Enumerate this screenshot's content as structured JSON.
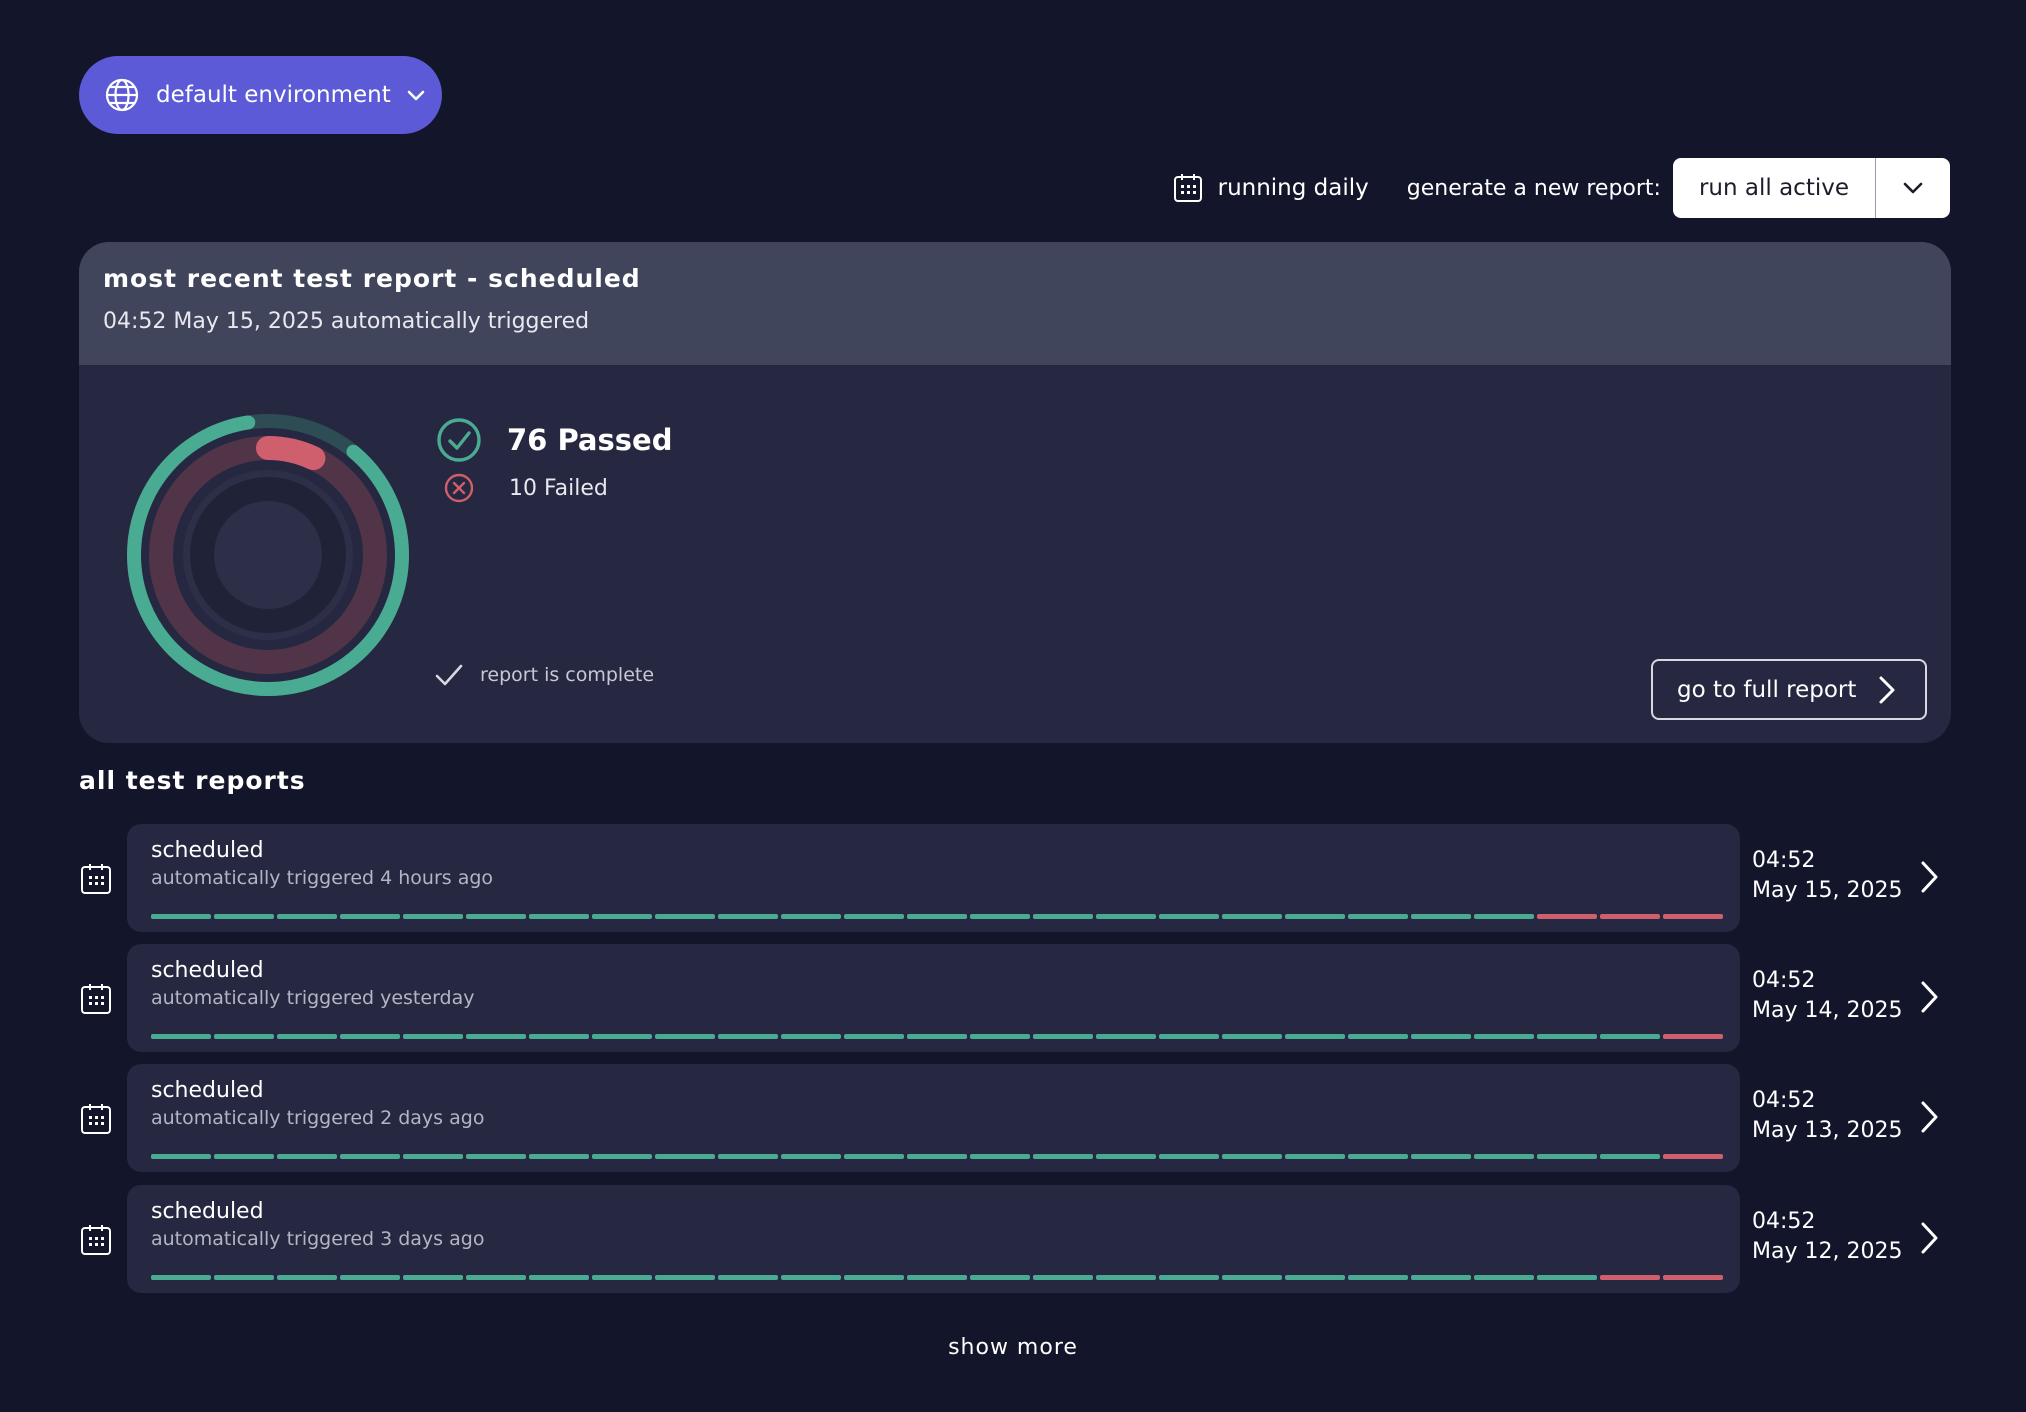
{
  "environment": {
    "label": "default environment",
    "icon": "globe-icon"
  },
  "toolbar": {
    "schedule_label": "running daily",
    "generate_label": "generate a new report:",
    "run_button_label": "run all active"
  },
  "latest_report": {
    "title": "most recent test report - scheduled",
    "subtitle": "04:52 May 15, 2025 automatically triggered",
    "passed_label": "76 Passed",
    "failed_label": "10 Failed",
    "passed": 76,
    "failed": 10,
    "status_label": "report is complete",
    "full_report_label": "go to full report"
  },
  "reports_section": {
    "title": "all test reports"
  },
  "reports": [
    {
      "title": "scheduled",
      "subtitle": "automatically triggered 4 hours ago",
      "time": "04:52",
      "date": "May 15, 2025",
      "passed_segments": 22,
      "failed_segments": 3
    },
    {
      "title": "scheduled",
      "subtitle": "automatically triggered yesterday",
      "time": "04:52",
      "date": "May 14, 2025",
      "passed_segments": 24,
      "failed_segments": 1
    },
    {
      "title": "scheduled",
      "subtitle": "automatically triggered 2 days ago",
      "time": "04:52",
      "date": "May 13, 2025",
      "passed_segments": 24,
      "failed_segments": 1
    },
    {
      "title": "scheduled",
      "subtitle": "automatically triggered 3 days ago",
      "time": "04:52",
      "date": "May 12, 2025",
      "passed_segments": 23,
      "failed_segments": 2
    }
  ],
  "show_more_label": "show more",
  "colors": {
    "background": "#13152a",
    "card": "#252840",
    "card_header": "#40455c",
    "accent": "#5c5ad6",
    "passed": "#4aab93",
    "failed": "#cf5f6c"
  }
}
